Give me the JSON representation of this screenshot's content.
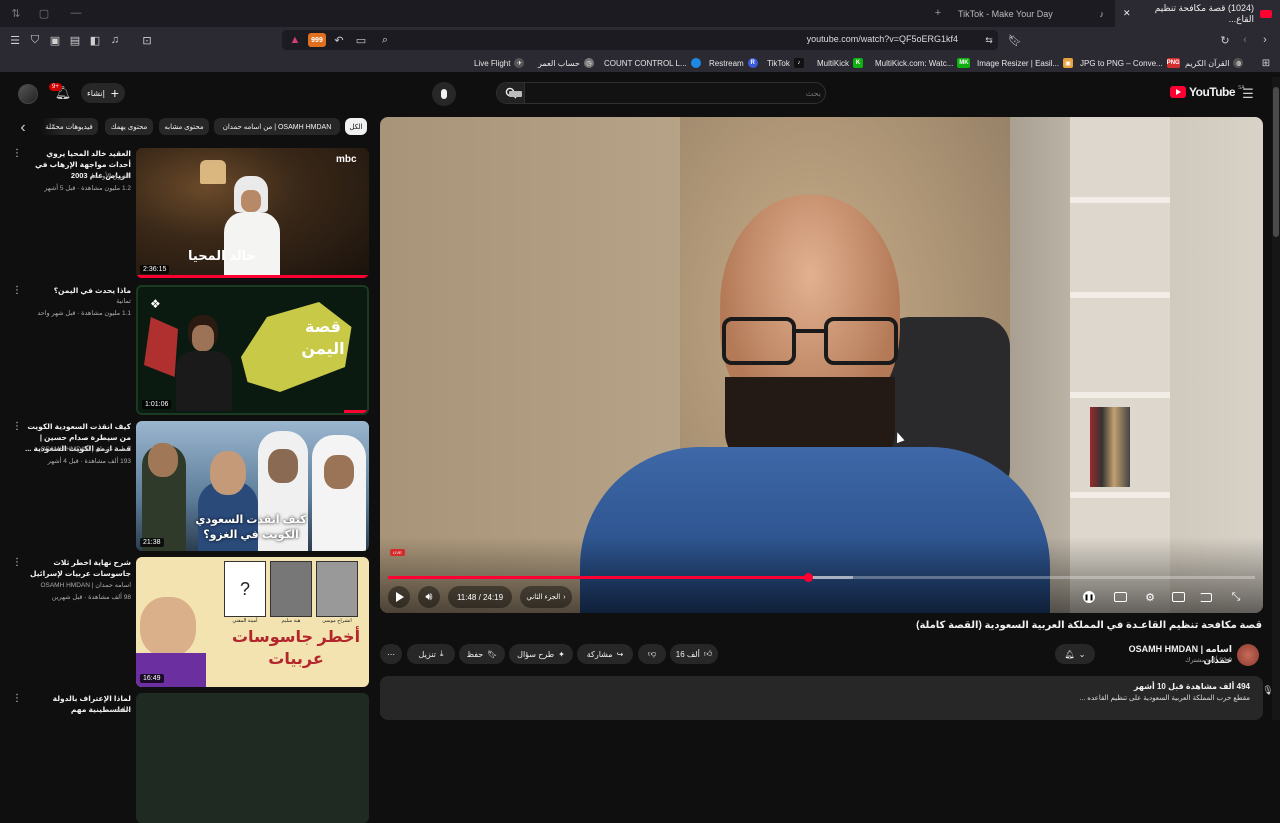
{
  "browser": {
    "tabs": [
      {
        "title": "(1024) قصة مكافحة تنظيم القاع..."
      },
      {
        "title": "TikTok - Make Your Day"
      }
    ],
    "url": "youtube.com/watch?v=QF5oERG1kf4",
    "bookmarks": [
      {
        "label": "Live Flight",
        "icon": "plane-icon",
        "color": "#555555"
      },
      {
        "label": "حساب العمر",
        "icon": "clock-icon",
        "color": "#777777"
      },
      {
        "label": "COUNT CONTROL L...",
        "icon": "circle-icon",
        "color": "#1e88e5"
      },
      {
        "label": "Restream",
        "icon": "R",
        "color": "#3b5bdb"
      },
      {
        "label": "TikTok",
        "icon": "tiktok-icon",
        "color": "#111111"
      },
      {
        "label": "MultiKick",
        "icon": "K",
        "color": "#10b010"
      },
      {
        "label": "MultiKick.com: Watc...",
        "icon": "MK",
        "color": "#10b010"
      },
      {
        "label": "Image Resizer | Easil...",
        "icon": "image-icon",
        "color": "#e6a23c"
      },
      {
        "label": "JPG to PNG – Conve...",
        "icon": "PNG",
        "color": "#d32f2f"
      },
      {
        "label": "القرآن الكريم",
        "icon": "globe-icon",
        "color": "#555555"
      }
    ]
  },
  "youtube": {
    "logo": "YouTube",
    "region": "SA",
    "search_placeholder": "بحث",
    "create_label": "إنشاء",
    "notifications_count": "9+",
    "chips": [
      "الكل",
      "من اسامه حمدان | OSAMH HMDAN",
      "محتوى مشابه",
      "محتوى يهمك",
      "فيديوهات محمّلة"
    ]
  },
  "recommendations": [
    {
      "title": "العقيد خالد المحيا يروي أحداث مواجهة الإرهاب في الرياض عام 2003",
      "channel": "الشرق الأوسط",
      "meta": "1.2 مليون مشاهدة · قبل 5 أشهر",
      "duration": "2:36:15",
      "thumb_text": "خالد المحيا",
      "thumb_badge": "mbc"
    },
    {
      "title": "ماذا يحدث في اليمن؟",
      "channel": "ثمانية",
      "meta": "1.1 مليون مشاهدة · قبل شهر واحد",
      "duration": "1:01:06",
      "thumb_text": "قصة اليمن"
    },
    {
      "title": "كيف انقذت السعودية الكويت من سيطرة صدام حسين | قصة ازمة الكويت السعودية ...",
      "channel": "اسامه حمدان | OSAMH HMDAN",
      "meta": "193 ألف مشاهدة · قبل 4 أشهر",
      "duration": "21:38",
      "thumb_text": "كيف انقذت السعودي الكويت في الغزو؟"
    },
    {
      "title": "شرح نهاية اخطر ثلاث جاسوسات عربيات لإسرائيل",
      "channel": "اسامه حمدان | OSAMH HMDAN",
      "meta": "98 ألف مشاهدة · قبل شهرين",
      "duration": "16:49",
      "thumb_text": "أخطر جاسوسات عربيات",
      "thumb_names": [
        "أمينة المفتي",
        "هبة سليم",
        "انشراح موسى"
      ]
    },
    {
      "title": "لماذا الإعتراف بالدولة الفلسطينية مهم",
      "channel": "ثمانية",
      "meta": "",
      "duration": ""
    }
  ],
  "player": {
    "current_time": "11:48",
    "duration": "24:19",
    "time_display": "11:48 / 24:19",
    "progress": 0.485,
    "chapter": "الجزء الثاني",
    "overlay_badge": "LIVE",
    "video_title": "قصة مكافحة تنظيم القاعـدة في المملكة العربية السعودية (القصة كاملة)"
  },
  "channel": {
    "name": "OSAMH HMDAN | اسامه حمدان",
    "subscribers": "93.9 ألف مشترك"
  },
  "actions": {
    "likes": "16 ألف",
    "share": "مشاركة",
    "ask": "طرح سؤال",
    "save": "حفظ",
    "download": "تنزيل"
  },
  "description": {
    "stats": "494 ألف مشاهدة قبل 10 أشهر",
    "snippet": "مقطع حرب المملكة العربية السعودية على تنظيم القاعده ..."
  },
  "colors": {
    "accent": "#ff0033",
    "background": "#0f0f0f",
    "chip": "#272727"
  }
}
